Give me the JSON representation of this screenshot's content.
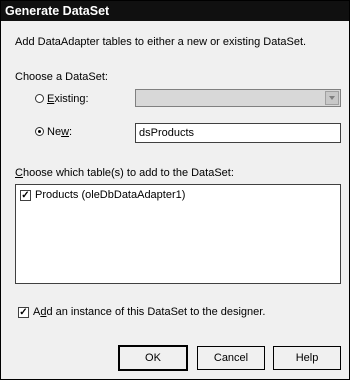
{
  "window": {
    "title": "Generate DataSet"
  },
  "intro_text": "Add DataAdapter tables to either a new or existing DataSet.",
  "choose_dataset": {
    "label": "Choose a DataSet:",
    "existing": {
      "accel": "E",
      "label_rest": "xisting:",
      "selected": false,
      "value": ""
    },
    "new": {
      "label_pre": "Ne",
      "accel": "w",
      "label_rest": ":",
      "selected": true,
      "value": "dsProducts"
    }
  },
  "tables": {
    "accel": "C",
    "label_rest": "hoose which table(s) to add to the DataSet:",
    "items": [
      {
        "label": "Products (oleDbDataAdapter1)",
        "checked": true,
        "check_glyph": "✓"
      }
    ]
  },
  "add_instance": {
    "label_pre": "A",
    "accel": "d",
    "label_rest": "d an instance of this DataSet to the designer.",
    "checked": true,
    "check_glyph": "✓"
  },
  "buttons": {
    "ok": "OK",
    "cancel": "Cancel",
    "help": "Help"
  },
  "colors": {
    "titlebar_bg": "#101010",
    "dialog_bg": "#f0f0f0"
  }
}
